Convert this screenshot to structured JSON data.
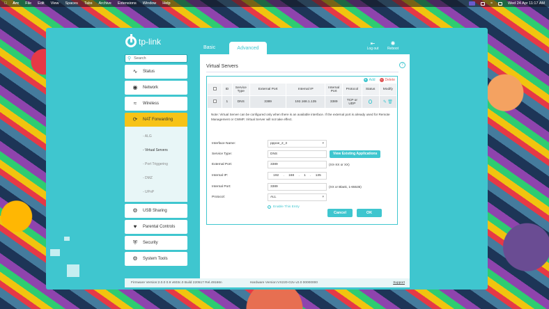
{
  "menubar": {
    "app": "Arc",
    "items": [
      "File",
      "Edit",
      "View",
      "Spaces",
      "Tabs",
      "Archive",
      "Extensions",
      "Window",
      "Help"
    ],
    "clock": "Wed 24 Apr  11:17 AM"
  },
  "brand": {
    "name": "tp-link"
  },
  "tabs": {
    "basic": "Basic",
    "advanced": "Advanced"
  },
  "top_actions": {
    "logout": "Log out",
    "reboot": "Reboot"
  },
  "sidebar": {
    "search_placeholder": "Search",
    "items": [
      {
        "label": "Status",
        "icon": "status-icon"
      },
      {
        "label": "Network",
        "icon": "globe-icon"
      },
      {
        "label": "Wireless",
        "icon": "wifi-icon"
      },
      {
        "label": "NAT Forwarding",
        "icon": "nat-icon"
      },
      {
        "label": "USB Sharing",
        "icon": "usb-icon"
      },
      {
        "label": "Parental Controls",
        "icon": "parental-icon"
      },
      {
        "label": "Security",
        "icon": "shield-icon"
      },
      {
        "label": "System Tools",
        "icon": "gear-icon"
      }
    ],
    "subitems": [
      "- ALG",
      "- Virtual Servers",
      "- Port Triggering",
      "- DMZ",
      "- UPnP"
    ]
  },
  "main": {
    "title": "Virtual Servers",
    "add_label": "Add",
    "delete_label": "Delete",
    "table": {
      "headers": [
        "",
        "ID",
        "Service Type",
        "External Port",
        "Internal IP",
        "Internal Port",
        "Protocol",
        "Status",
        "Modify"
      ],
      "rows": [
        {
          "id": "1",
          "service_type": "DNS",
          "external_port": "3389",
          "internal_ip": "192.168.1.135",
          "internal_port": "3389",
          "protocol": "TCP or UDP"
        }
      ]
    },
    "note": "Note: Virtual Server can be configured only when there is an available interface. If the external port is already used for Remote Management or CWMP, Virtual Server will not take effect.",
    "form": {
      "interface_label": "Interface Name:",
      "interface_value": "pppoe_2_3",
      "service_type_label": "Service Type:",
      "service_type_value": "DNS",
      "view_apps_label": "View Existing Applications",
      "external_port_label": "External Port:",
      "external_port_value": "3389",
      "external_port_hint": "(XX-XX or XX)",
      "internal_ip_label": "Internal IP:",
      "internal_ip_octets": [
        "192",
        "168",
        "1",
        "135"
      ],
      "internal_port_label": "Internal Port:",
      "internal_port_value": "3389",
      "internal_port_hint": "(XX or Blank, 1-65535)",
      "protocol_label": "Protocol:",
      "protocol_value": "ALL",
      "enable_label": "Enable This Entry",
      "cancel_label": "Cancel",
      "ok_label": "OK"
    }
  },
  "footer": {
    "firmware": "Firmware Version:2.0.0 0.9 v603c.0 Build 220517 Rel.49166n",
    "hardware": "Hardware Version:VX220-G2v v2.0 00000000",
    "support": "Support"
  },
  "colors": {
    "accent": "#3fc6cf",
    "active_nav": "#f7c317",
    "delete": "#e05656"
  }
}
